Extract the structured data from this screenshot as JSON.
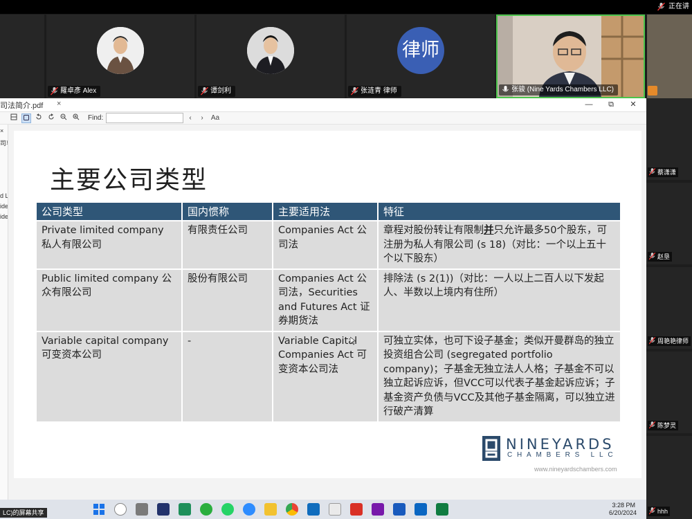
{
  "top_strip": {
    "status_tag": "正在讲",
    "participants": [
      {
        "name": "羅卓彥 Alex"
      },
      {
        "name": "谭剑利"
      },
      {
        "name": "张涟青 律师",
        "avatar_text": "律师"
      },
      {
        "name": "张骏 (Nine Yards Chambers LLC)"
      }
    ]
  },
  "right_column": {
    "participants": [
      {
        "name": "蔡潇潇"
      },
      {
        "name": "赵垦"
      },
      {
        "name": "周艳艳律师"
      },
      {
        "name": "陈梦灵"
      },
      {
        "name": "hhh"
      }
    ]
  },
  "pdf_viewer": {
    "file_tab": "司法简介.pdf",
    "tab_close": "×",
    "find_label": "Find:",
    "find_value": "",
    "case_toggle": "Aa",
    "sidebar_fragments": [
      "司尃",
      "d L",
      "ide",
      "ide"
    ],
    "window_controls": {
      "minimize": "—",
      "maximize": "⧉",
      "close": "✕"
    }
  },
  "slide": {
    "title": "主要公司类型",
    "table": {
      "headers": [
        "公司类型",
        "国内惯称",
        "主要适用法",
        "特征"
      ],
      "rows": [
        {
          "type": "Private limited company 私人有限公司",
          "domestic": "有限责任公司",
          "law": "Companies Act 公司法",
          "feature_before": "章程对股份转让有限制",
          "feature_emph": "并",
          "feature_after": "只允许最多50个股东，可注册为私人有限公司 (s 18)（对比：一个以上五十个以下股东）"
        },
        {
          "type": "Public limited company 公众有限公司",
          "domestic": "股份有限公司",
          "law": "Companies Act 公司法，Securities and Futures Act 证券期货法",
          "feature_before": "排除法 (s 2(1))（对比：一人以上二百人以下发起人、半数以上境内有住所）",
          "feature_emph": "",
          "feature_after": ""
        },
        {
          "type": "Variable capital company 可变资本公司",
          "domestic": "-",
          "law": "Variable Capital Companies Act 可变资本公司法",
          "feature_before": "可独立实体，也可下设子基金；类似开曼群岛的独立投资组合公司 (segregated portfolio company)；子基金无独立法人人格；子基金不可以独立起诉应诉，但VCC可以代表子基金起诉应诉；子基金资产负债与VCC及其他子基金隔离，可以独立进行破产清算",
          "feature_emph": "",
          "feature_after": ""
        }
      ]
    },
    "logo_line1": "NINEYARDS",
    "logo_line2": "CHAMBERS LLC",
    "logo_url": "www.nineyardschambers.com"
  },
  "taskbar": {
    "share_label": "LC)的屏幕共享",
    "time": "3:28 PM",
    "date": "6/20/2024"
  }
}
